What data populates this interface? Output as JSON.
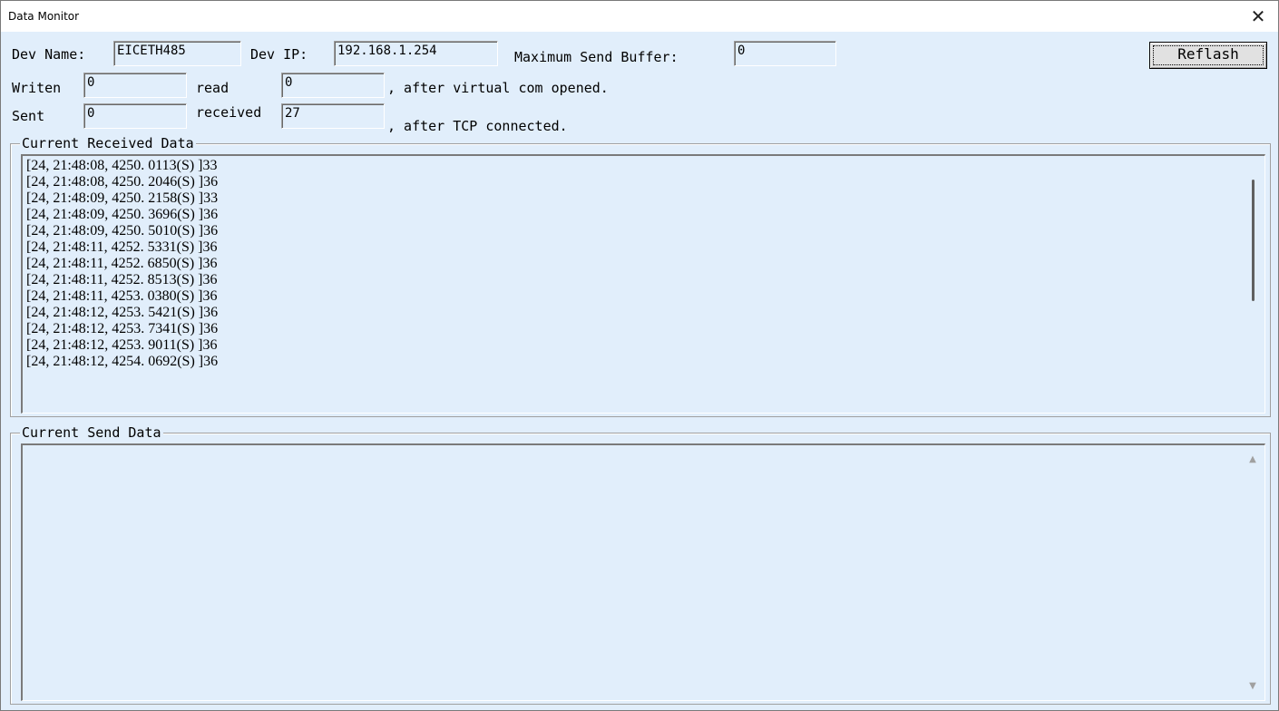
{
  "window": {
    "title": "Data Monitor",
    "close_glyph": "✕"
  },
  "device": {
    "name_label": "Dev Name:",
    "name_value": "EICETH485",
    "ip_label": "Dev IP:",
    "ip_value": "192.168.1.254",
    "max_buffer_label": "Maximum Send Buffer:",
    "max_buffer_value": "0",
    "refresh_label": "Reflash"
  },
  "virtual_com": {
    "written_label": "Writen",
    "written_value": "0",
    "read_label": "read",
    "read_value": "0",
    "note": ", after virtual com opened."
  },
  "tcp": {
    "sent_label": "Sent",
    "sent_value": "0",
    "received_label": "received",
    "received_value": "27",
    "note": ", after TCP connected."
  },
  "received": {
    "title": "Current Received Data",
    "lines": [
      "[24, 21:48:08, 4250. 0113(S) ]33",
      "[24, 21:48:08, 4250. 2046(S) ]36",
      "[24, 21:48:09, 4250. 2158(S) ]33",
      "[24, 21:48:09, 4250. 3696(S) ]36",
      "[24, 21:48:09, 4250. 5010(S) ]36",
      "[24, 21:48:11, 4252. 5331(S) ]36",
      "[24, 21:48:11, 4252. 6850(S) ]36",
      "[24, 21:48:11, 4252. 8513(S) ]36",
      "[24, 21:48:11, 4253. 0380(S) ]36",
      "[24, 21:48:12, 4253. 5421(S) ]36",
      "[24, 21:48:12, 4253. 7341(S) ]36",
      "[24, 21:48:12, 4253. 9011(S) ]36",
      "[24, 21:48:12, 4254. 0692(S) ]36"
    ]
  },
  "send": {
    "title": "Current Send Data",
    "content": "",
    "scroll_up_icon": "scroll-up-arrow-icon",
    "scroll_down_icon": "scroll-down-arrow-icon"
  }
}
